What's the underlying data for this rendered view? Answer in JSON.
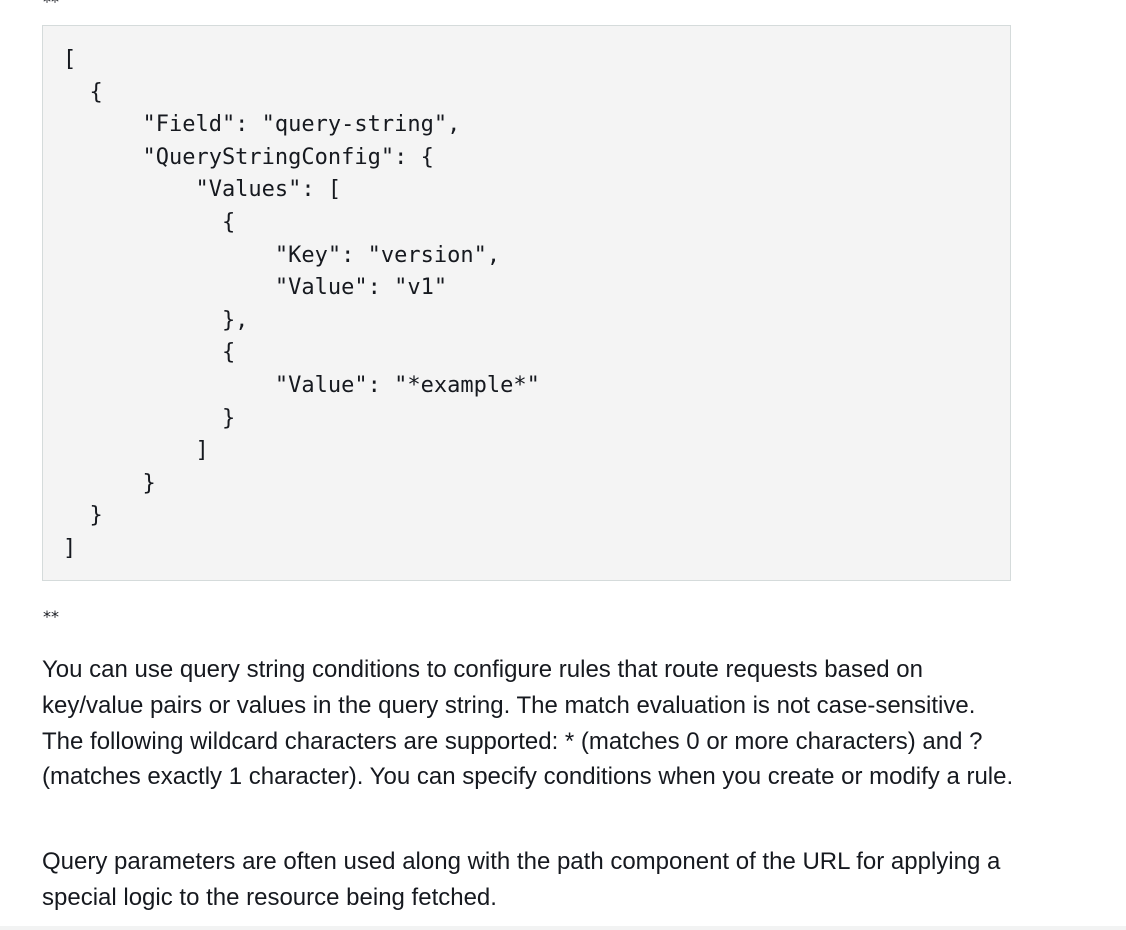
{
  "markers": {
    "top": "**",
    "bottom": "**"
  },
  "code": {
    "lines": [
      "[",
      "  {",
      "      \"Field\": \"query-string\",",
      "      \"QueryStringConfig\": {",
      "          \"Values\": [",
      "            {",
      "                \"Key\": \"version\",",
      "                \"Value\": \"v1\"",
      "            },",
      "            {",
      "                \"Value\": \"*example*\"",
      "            }",
      "          ]",
      "      }",
      "  }",
      "]"
    ]
  },
  "paragraphs": {
    "first": "You can use query string conditions to configure rules that route requests based on key/value pairs or values in the query string. The match evaluation is not case-sensitive. The following wildcard characters are supported: * (matches 0 or more characters) and ? (matches exactly 1 character). You can specify conditions when you create or modify a rule.",
    "second": "Query parameters are often used along with the path component of the URL for applying a special logic to the resource being fetched."
  }
}
